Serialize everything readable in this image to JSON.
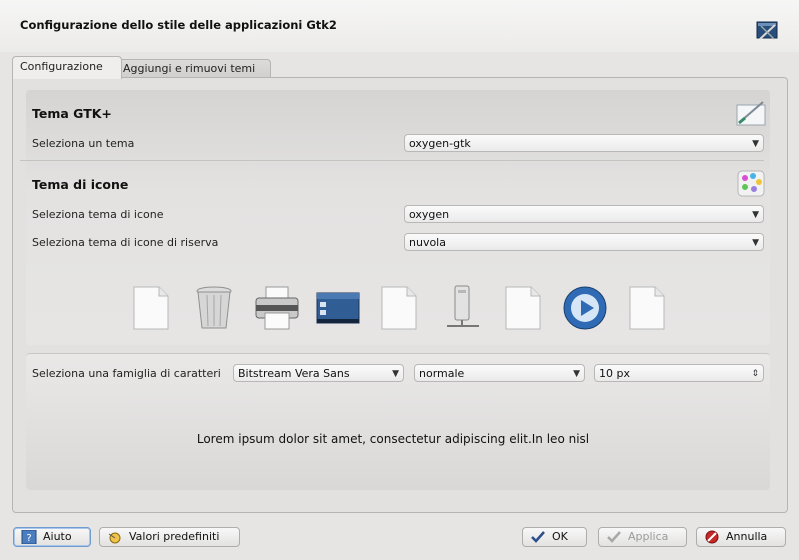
{
  "window": {
    "title": "Configurazione dello stile delle applicazioni Gtk2",
    "header_icon": "gtk-config-icon"
  },
  "tabs": [
    {
      "label": "Configurazione",
      "active": true
    },
    {
      "label": "Aggiungi e rimuovi temi",
      "active": false
    }
  ],
  "gtk_theme": {
    "title": "Tema GTK+",
    "select_label": "Seleziona un tema",
    "selected": "oxygen-gtk",
    "icon": "paint-brush-icon"
  },
  "icon_theme": {
    "title": "Tema di icone",
    "select_label": "Seleziona tema di icone",
    "selected": "oxygen",
    "fallback_label": "Seleziona tema di icone di riserva",
    "fallback_selected": "nuvola",
    "icon": "palette-icon"
  },
  "preview_icons": [
    "blank-document-icon",
    "trash-can-icon",
    "printer-icon",
    "desktop-icon",
    "blank-document-icon",
    "server-icon",
    "blank-document-icon",
    "media-player-icon",
    "blank-document-icon"
  ],
  "font": {
    "label": "Seleziona una famiglia di caratteri",
    "family": "Bitstream Vera Sans",
    "style": "normale",
    "size": "10 px"
  },
  "preview_text": "Lorem ipsum dolor sit amet, consectetur adipiscing elit.In leo nisl",
  "buttons": {
    "help": "Aiuto",
    "defaults": "Valori predefiniti",
    "ok": "OK",
    "apply": "Applica",
    "cancel": "Annulla"
  },
  "colors": {
    "accent": "#2e6db4",
    "cancel_red": "#c62828",
    "ok_blue": "#2b4f8a"
  }
}
